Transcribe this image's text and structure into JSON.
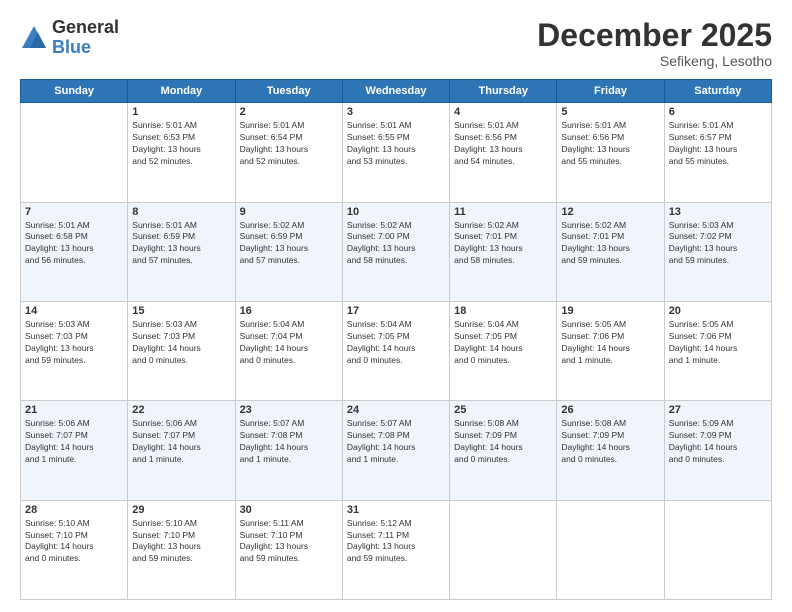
{
  "header": {
    "logo_general": "General",
    "logo_blue": "Blue",
    "month_title": "December 2025",
    "location": "Sefikeng, Lesotho"
  },
  "days_of_week": [
    "Sunday",
    "Monday",
    "Tuesday",
    "Wednesday",
    "Thursday",
    "Friday",
    "Saturday"
  ],
  "weeks": [
    [
      {
        "day": "",
        "info": ""
      },
      {
        "day": "1",
        "info": "Sunrise: 5:01 AM\nSunset: 6:53 PM\nDaylight: 13 hours\nand 52 minutes."
      },
      {
        "day": "2",
        "info": "Sunrise: 5:01 AM\nSunset: 6:54 PM\nDaylight: 13 hours\nand 52 minutes."
      },
      {
        "day": "3",
        "info": "Sunrise: 5:01 AM\nSunset: 6:55 PM\nDaylight: 13 hours\nand 53 minutes."
      },
      {
        "day": "4",
        "info": "Sunrise: 5:01 AM\nSunset: 6:56 PM\nDaylight: 13 hours\nand 54 minutes."
      },
      {
        "day": "5",
        "info": "Sunrise: 5:01 AM\nSunset: 6:56 PM\nDaylight: 13 hours\nand 55 minutes."
      },
      {
        "day": "6",
        "info": "Sunrise: 5:01 AM\nSunset: 6:57 PM\nDaylight: 13 hours\nand 55 minutes."
      }
    ],
    [
      {
        "day": "7",
        "info": "Sunrise: 5:01 AM\nSunset: 6:58 PM\nDaylight: 13 hours\nand 56 minutes."
      },
      {
        "day": "8",
        "info": "Sunrise: 5:01 AM\nSunset: 6:59 PM\nDaylight: 13 hours\nand 57 minutes."
      },
      {
        "day": "9",
        "info": "Sunrise: 5:02 AM\nSunset: 6:59 PM\nDaylight: 13 hours\nand 57 minutes."
      },
      {
        "day": "10",
        "info": "Sunrise: 5:02 AM\nSunset: 7:00 PM\nDaylight: 13 hours\nand 58 minutes."
      },
      {
        "day": "11",
        "info": "Sunrise: 5:02 AM\nSunset: 7:01 PM\nDaylight: 13 hours\nand 58 minutes."
      },
      {
        "day": "12",
        "info": "Sunrise: 5:02 AM\nSunset: 7:01 PM\nDaylight: 13 hours\nand 59 minutes."
      },
      {
        "day": "13",
        "info": "Sunrise: 5:03 AM\nSunset: 7:02 PM\nDaylight: 13 hours\nand 59 minutes."
      }
    ],
    [
      {
        "day": "14",
        "info": "Sunrise: 5:03 AM\nSunset: 7:03 PM\nDaylight: 13 hours\nand 59 minutes."
      },
      {
        "day": "15",
        "info": "Sunrise: 5:03 AM\nSunset: 7:03 PM\nDaylight: 14 hours\nand 0 minutes."
      },
      {
        "day": "16",
        "info": "Sunrise: 5:04 AM\nSunset: 7:04 PM\nDaylight: 14 hours\nand 0 minutes."
      },
      {
        "day": "17",
        "info": "Sunrise: 5:04 AM\nSunset: 7:05 PM\nDaylight: 14 hours\nand 0 minutes."
      },
      {
        "day": "18",
        "info": "Sunrise: 5:04 AM\nSunset: 7:05 PM\nDaylight: 14 hours\nand 0 minutes."
      },
      {
        "day": "19",
        "info": "Sunrise: 5:05 AM\nSunset: 7:06 PM\nDaylight: 14 hours\nand 1 minute."
      },
      {
        "day": "20",
        "info": "Sunrise: 5:05 AM\nSunset: 7:06 PM\nDaylight: 14 hours\nand 1 minute."
      }
    ],
    [
      {
        "day": "21",
        "info": "Sunrise: 5:06 AM\nSunset: 7:07 PM\nDaylight: 14 hours\nand 1 minute."
      },
      {
        "day": "22",
        "info": "Sunrise: 5:06 AM\nSunset: 7:07 PM\nDaylight: 14 hours\nand 1 minute."
      },
      {
        "day": "23",
        "info": "Sunrise: 5:07 AM\nSunset: 7:08 PM\nDaylight: 14 hours\nand 1 minute."
      },
      {
        "day": "24",
        "info": "Sunrise: 5:07 AM\nSunset: 7:08 PM\nDaylight: 14 hours\nand 1 minute."
      },
      {
        "day": "25",
        "info": "Sunrise: 5:08 AM\nSunset: 7:09 PM\nDaylight: 14 hours\nand 0 minutes."
      },
      {
        "day": "26",
        "info": "Sunrise: 5:08 AM\nSunset: 7:09 PM\nDaylight: 14 hours\nand 0 minutes."
      },
      {
        "day": "27",
        "info": "Sunrise: 5:09 AM\nSunset: 7:09 PM\nDaylight: 14 hours\nand 0 minutes."
      }
    ],
    [
      {
        "day": "28",
        "info": "Sunrise: 5:10 AM\nSunset: 7:10 PM\nDaylight: 14 hours\nand 0 minutes."
      },
      {
        "day": "29",
        "info": "Sunrise: 5:10 AM\nSunset: 7:10 PM\nDaylight: 13 hours\nand 59 minutes."
      },
      {
        "day": "30",
        "info": "Sunrise: 5:11 AM\nSunset: 7:10 PM\nDaylight: 13 hours\nand 59 minutes."
      },
      {
        "day": "31",
        "info": "Sunrise: 5:12 AM\nSunset: 7:11 PM\nDaylight: 13 hours\nand 59 minutes."
      },
      {
        "day": "",
        "info": ""
      },
      {
        "day": "",
        "info": ""
      },
      {
        "day": "",
        "info": ""
      }
    ]
  ]
}
